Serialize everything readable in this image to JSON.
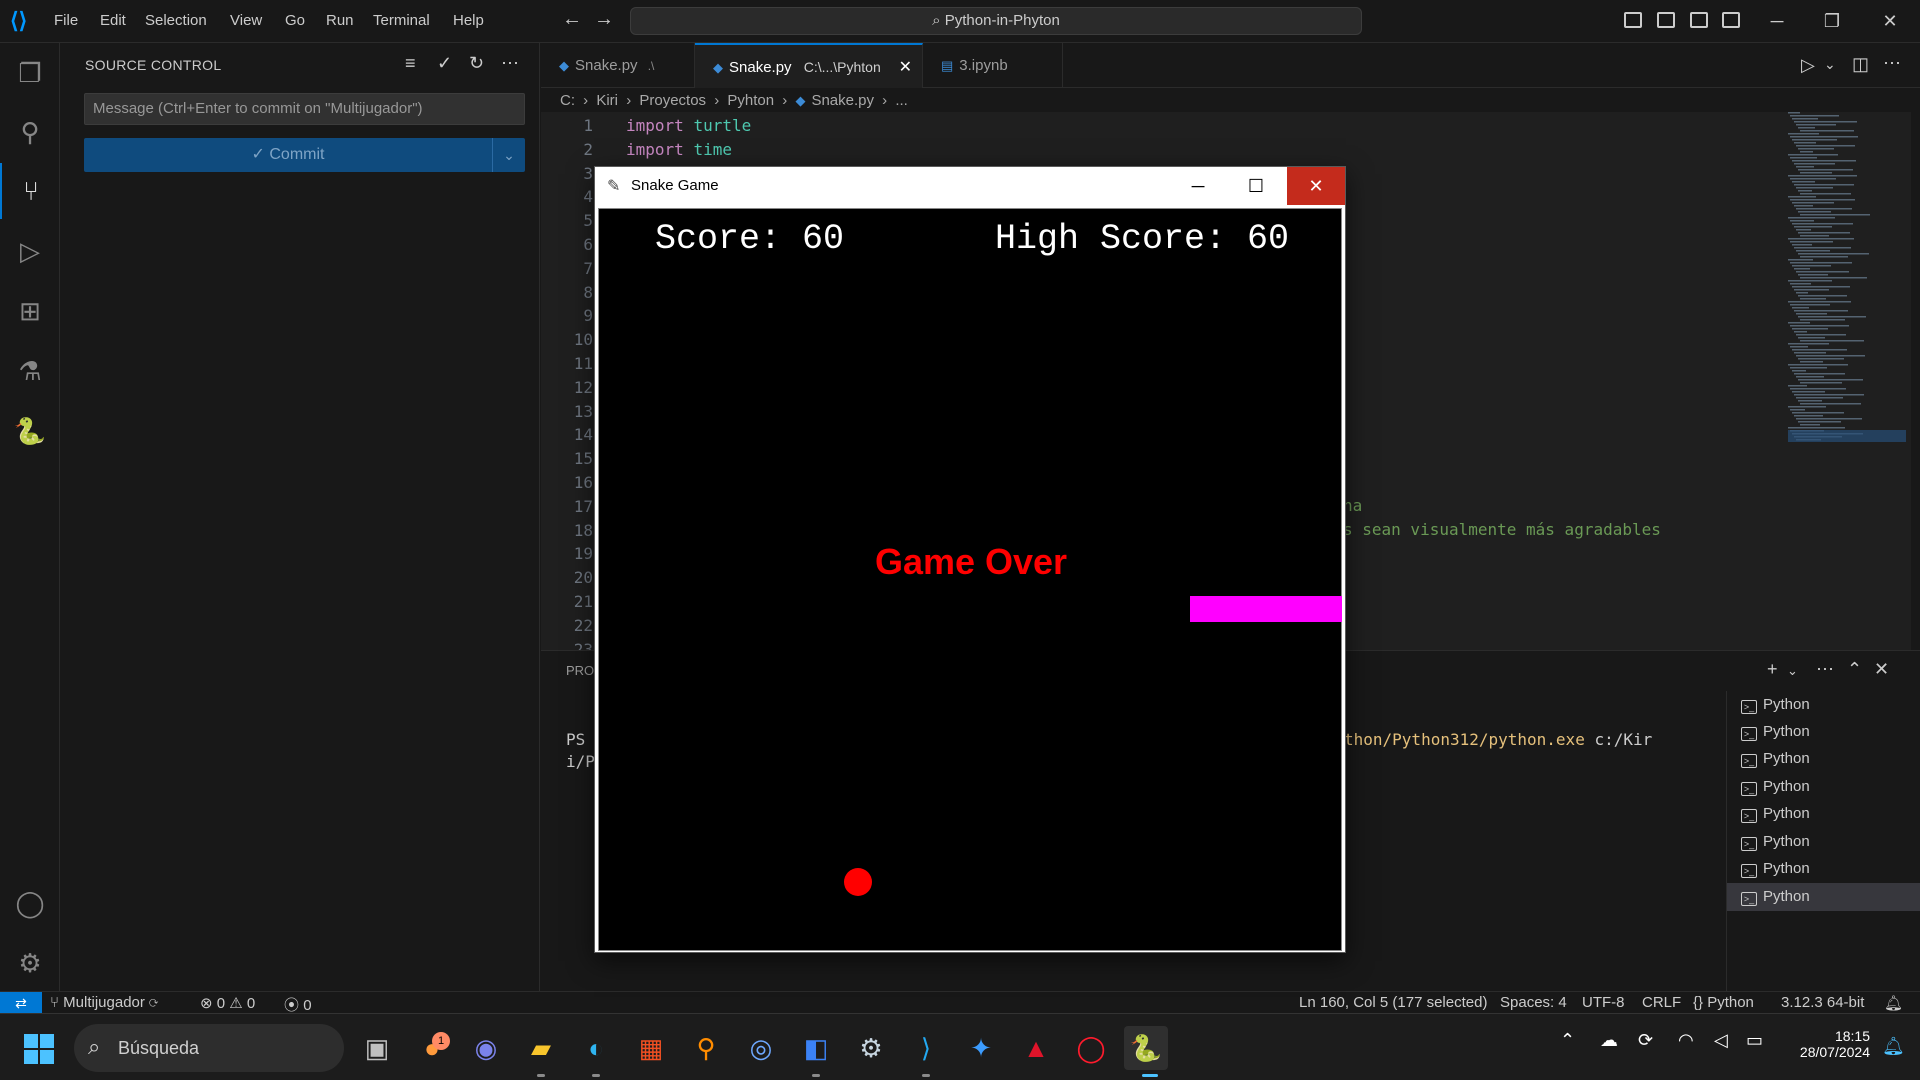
{
  "menubar": {
    "items": [
      "File",
      "Edit",
      "Selection",
      "View",
      "Go",
      "Run",
      "Terminal",
      "Help"
    ],
    "command_center": "Python-in-Phyton"
  },
  "sidebar": {
    "title": "SOURCE CONTROL",
    "commit_placeholder": "Message (Ctrl+Enter to commit on \"Multijugador\")",
    "commit_button": "Commit"
  },
  "tabs": [
    {
      "label": "Snake.py",
      "hint": ".\\"
    },
    {
      "label": "Snake.py",
      "hint": "C:\\...\\Pyhton"
    },
    {
      "label": "3.ipynb",
      "hint": ""
    }
  ],
  "breadcrumb": [
    "C:",
    "Kiri",
    "Proyectos",
    "Pyhton",
    "Snake.py",
    "..."
  ],
  "editor": {
    "line_numbers": [
      "1",
      "2",
      "3",
      "4",
      "5",
      "6",
      "7",
      "8",
      "9",
      "10",
      "11",
      "12",
      "13",
      "14",
      "15",
      "16",
      "17",
      "18",
      "19",
      "20",
      "21",
      "22",
      "23"
    ],
    "line1_kw": "import",
    "line1_mod": "turtle",
    "line2_kw": "import",
    "line2_mod": "time",
    "line17_fragment": "na",
    "line18_fragment": "s sean visualmente más agradables"
  },
  "panel": {
    "tab_label": "PRO",
    "term_line1_prefix": "PS",
    "term_line1_path": "thon/Python312/python.exe",
    "term_line1_rest": " c:/Kir",
    "term_line2": "i/P",
    "terminals": [
      "Python",
      "Python",
      "Python",
      "Python",
      "Python",
      "Python",
      "Python",
      "Python"
    ]
  },
  "statusbar": {
    "branch": "Multijugador",
    "errors": "0",
    "warnings": "0",
    "ports": "0",
    "position": "Ln 160, Col 5 (177 selected)",
    "spaces": "Spaces: 4",
    "encoding": "UTF-8",
    "eol": "CRLF",
    "language": "Python",
    "interpreter": "3.12.3 64-bit"
  },
  "snake_window": {
    "title": "Snake Game",
    "score": "Score: 60",
    "high_score": "High Score: 60",
    "game_over": "Game Over"
  },
  "taskbar": {
    "search_label": "Búsqueda",
    "badge_count": "1",
    "time": "18:15",
    "date": "28/07/2024"
  },
  "colors": {
    "accent": "#0078d4",
    "snake": "#ff00ff",
    "food": "#ff0000",
    "game_over": "#ff0000"
  }
}
